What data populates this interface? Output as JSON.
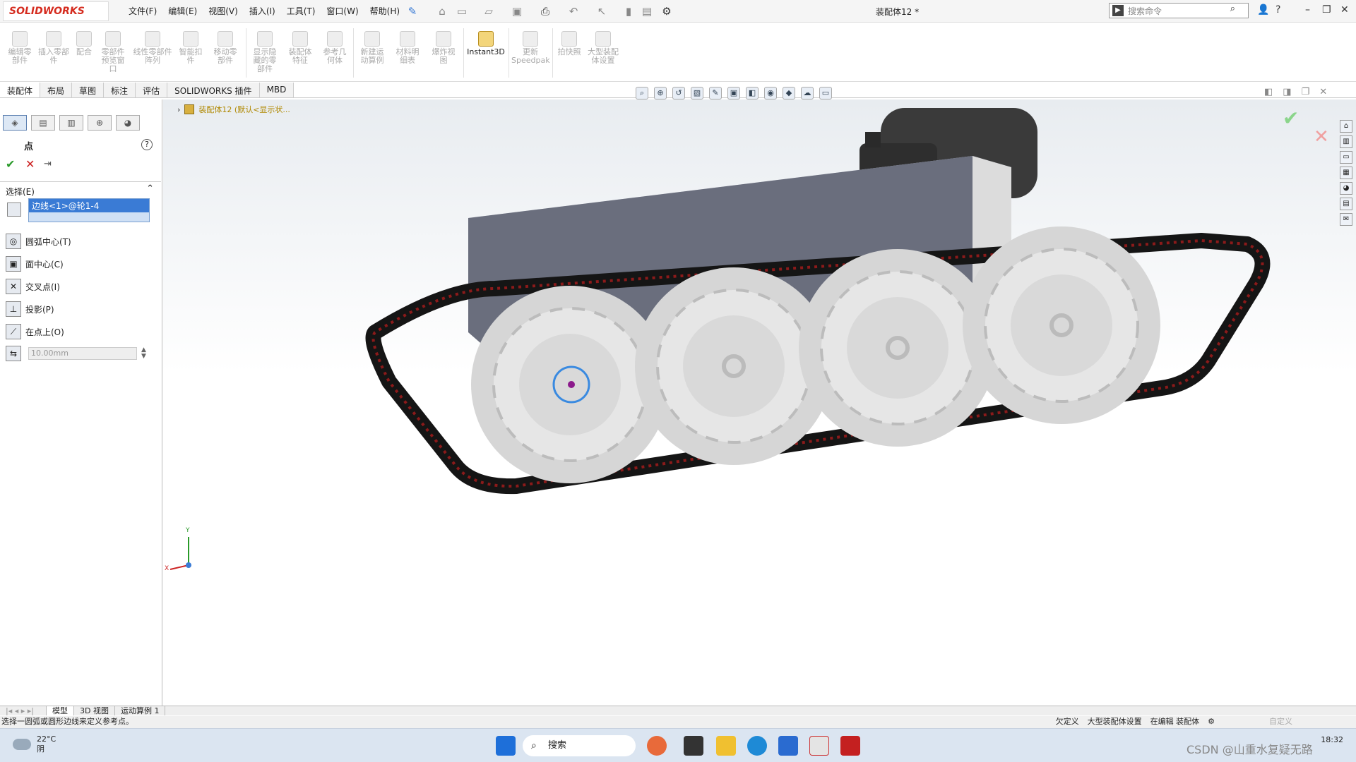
{
  "app": {
    "logo": "SOLIDWORKS",
    "document_title": "装配体12 *"
  },
  "menus": [
    "文件(F)",
    "编辑(E)",
    "视图(V)",
    "插入(I)",
    "工具(T)",
    "窗口(W)",
    "帮助(H)"
  ],
  "search": {
    "placeholder": "搜索命令"
  },
  "ribbon": [
    {
      "label": "编辑零部件"
    },
    {
      "label": "插入零部件"
    },
    {
      "label": "配合"
    },
    {
      "label": "零部件预览窗口"
    },
    {
      "label": "线性零部件阵列"
    },
    {
      "label": "智能扣件"
    },
    {
      "label": "移动零部件"
    },
    {
      "label": "显示隐藏的零部件"
    },
    {
      "label": "装配体特征"
    },
    {
      "label": "参考几何体"
    },
    {
      "label": "新建运动算例"
    },
    {
      "label": "材料明细表"
    },
    {
      "label": "爆炸视图"
    },
    {
      "label": "Instant3D"
    },
    {
      "label": "更新Speedpak"
    },
    {
      "label": "拍快照"
    },
    {
      "label": "大型装配体设置"
    }
  ],
  "cm_tabs": [
    "装配体",
    "布局",
    "草图",
    "标注",
    "评估",
    "SOLIDWORKS 插件",
    "MBD"
  ],
  "panel": {
    "title": "点",
    "selection_header": "选择(E)",
    "selected_item": "边线<1>@轮1-4",
    "options": [
      "圆弧中心(T)",
      "面中心(C)",
      "交叉点(I)",
      "投影(P)",
      "在点上(O)"
    ],
    "distance": "10.00mm"
  },
  "tree": {
    "root": "装配体12 (默认<显示状..."
  },
  "axes": {
    "x": "X",
    "y": "Y"
  },
  "bottom_tabs": [
    "模型",
    "3D 视图",
    "运动算例 1"
  ],
  "status": {
    "message": "选择一圆弧或圆形边线来定义参考点。",
    "items": [
      "欠定义",
      "大型装配体设置",
      "在编辑 装配体"
    ],
    "custom": "自定义"
  },
  "taskbar": {
    "weather_temp": "22°C",
    "weather_desc": "阴",
    "search": "搜索",
    "time": "18:32",
    "watermark": "CSDN @山重水复疑无路"
  },
  "colors": {
    "track": "#1a1a1a",
    "track_accent": "#8b1a1a",
    "wheel": "#d9d9d9",
    "body": "#6e7280",
    "motor": "#333333",
    "accent": "#3a7bd5"
  }
}
